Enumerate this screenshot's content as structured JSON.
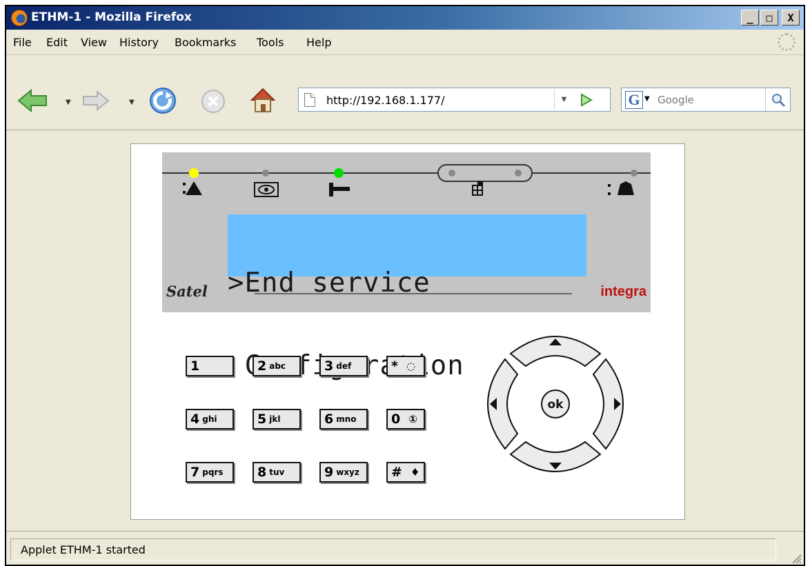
{
  "window": {
    "title": "ETHM-1 - Mozilla Firefox",
    "minimize": "_",
    "maximize": "□",
    "close": "X"
  },
  "menu": [
    "File",
    "Edit",
    "View",
    "History",
    "Bookmarks",
    "Tools",
    "Help"
  ],
  "nav": {
    "url": "http://192.168.1.177/",
    "search_placeholder": "Google",
    "search_engine_letter": "G"
  },
  "keypad_display": {
    "line1": ">End service",
    "line2": " Configuration",
    "brand_left": "Satel",
    "brand_right": "integra",
    "led_colors": {
      "alarm": "#ffff00",
      "armed": "#888888",
      "service": "#00e000",
      "trouble": "#888888"
    }
  },
  "keys": [
    {
      "digit": "1",
      "sub": ""
    },
    {
      "digit": "2",
      "sub": "abc"
    },
    {
      "digit": "3",
      "sub": "def"
    },
    {
      "digit": "*",
      "sub": ""
    },
    {
      "digit": "4",
      "sub": "ghi"
    },
    {
      "digit": "5",
      "sub": "jkl"
    },
    {
      "digit": "6",
      "sub": "mno"
    },
    {
      "digit": "0",
      "sub": ""
    },
    {
      "digit": "7",
      "sub": "pqrs"
    },
    {
      "digit": "8",
      "sub": "tuv"
    },
    {
      "digit": "9",
      "sub": "wxyz"
    },
    {
      "digit": "#",
      "sub": ""
    }
  ],
  "ok_label": "ok",
  "status": {
    "text": "Applet ETHM-1 started"
  }
}
